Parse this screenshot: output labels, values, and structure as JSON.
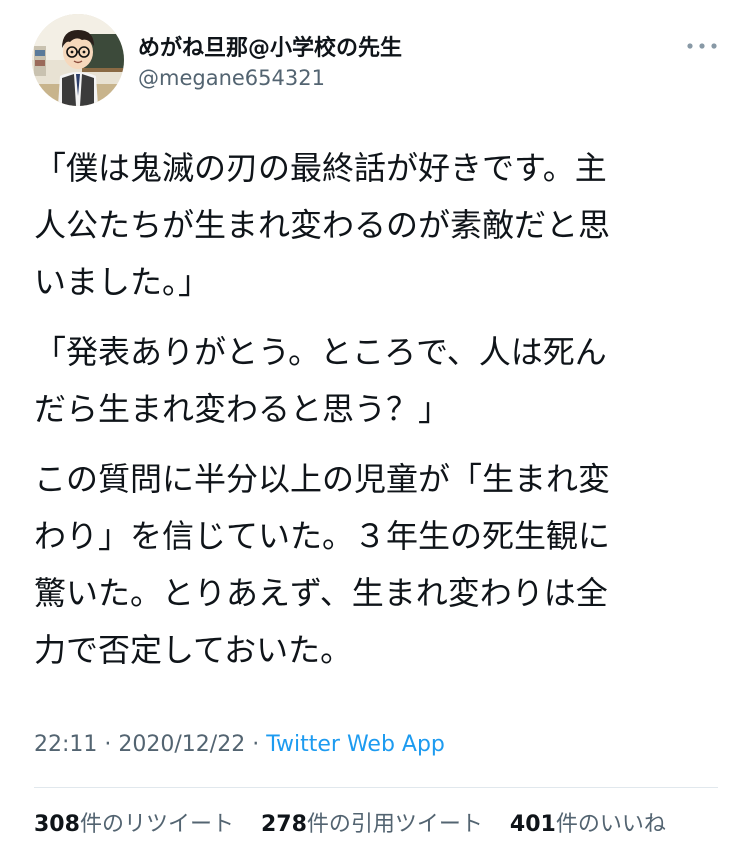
{
  "user": {
    "name": "めがね旦那@小学校の先生",
    "handle": "@megane654321"
  },
  "tweet": {
    "lines": [
      [
        "「僕は鬼滅の刃の最終話が好きです。主",
        "人公たちが生まれ変わるのが素敵だと思",
        "いました。」"
      ],
      [
        "「発表ありがとう。ところで、人は死ん",
        "だら生まれ変わると思う？」"
      ],
      [
        "この質問に半分以上の児童が「生まれ変",
        "わり」を信じていた。３年生の死生観に",
        "驚いた。とりあえず、生まれ変わりは全",
        "力で否定しておいた。"
      ]
    ]
  },
  "meta": {
    "time": "22:11",
    "date": "2020/12/22",
    "separator": "·",
    "source": "Twitter Web App"
  },
  "stats": {
    "retweets": {
      "count": "308",
      "label": "件のリツイート"
    },
    "quotes": {
      "count": "278",
      "label": "件の引用ツイート"
    },
    "likes": {
      "count": "401",
      "label": "件のいいね"
    }
  },
  "colors": {
    "text": "#0f1419",
    "secondary": "#536471",
    "link": "#1d9bf0",
    "divider": "#e1e8ed"
  },
  "icons": {
    "avatar": "cartoon-teacher-avatar",
    "more": "more-horizontal-icon"
  }
}
